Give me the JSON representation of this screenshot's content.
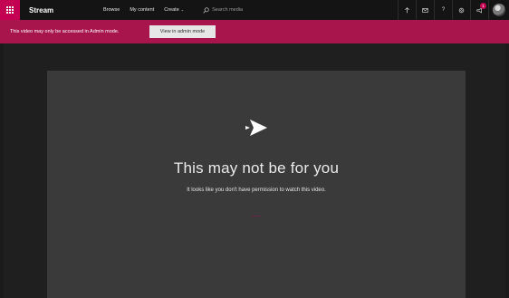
{
  "topbar": {
    "brand": "Stream",
    "nav": [
      {
        "label": "Browse"
      },
      {
        "label": "My content"
      },
      {
        "label": "Create"
      }
    ],
    "search_placeholder": "Search media",
    "notifications_count": "1",
    "icons": [
      "waffle-icon",
      "search-icon",
      "upload-icon",
      "mail-icon",
      "help-icon",
      "settings-icon",
      "megaphone-icon"
    ]
  },
  "banner": {
    "text": "This video may only be accessed in Admin mode.",
    "button": "View in admin mode"
  },
  "message": {
    "title": "This may not be for you",
    "body": "It looks like you don't have permission to watch this video.",
    "link": "____"
  },
  "colors": {
    "brand": "#c30052",
    "banner": "#a8154d",
    "topbar": "#141414",
    "panel": "#3a3a3a"
  }
}
